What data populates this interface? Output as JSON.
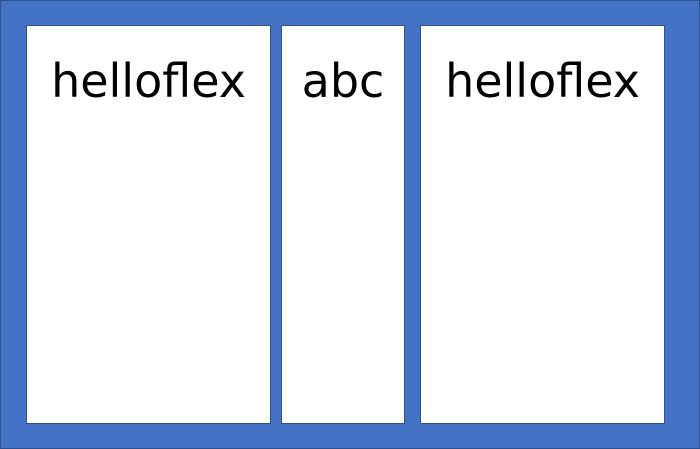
{
  "flex_container": {
    "fill_color": "#4472c4",
    "border_color": "#2f528f",
    "items": [
      {
        "label": "helloflex",
        "fill_color": "#ffffff"
      },
      {
        "label": "abc",
        "fill_color": "#ffffff"
      },
      {
        "label": "helloflex",
        "fill_color": "#ffffff"
      }
    ]
  }
}
